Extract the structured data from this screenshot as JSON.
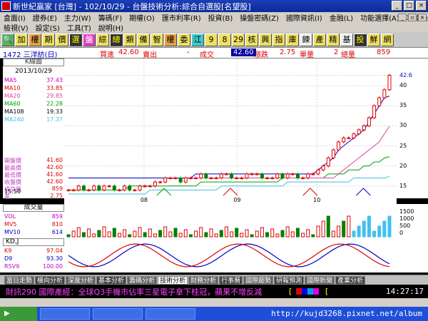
{
  "window": {
    "title": "新世紀贏家 [台灣] - 102/10/29 - 台盤技術分析:綜合自選股[名望股]"
  },
  "menu": {
    "row1": [
      "盒面(I)",
      "證券(E)",
      "主力(W)",
      "籌碼(F)",
      "期權(O)",
      "匯市利率(R)",
      "投資(B)",
      "操盤密碼(Z)",
      "國際資訊(I)",
      "金融(L)",
      "功能選擇(A)",
      "功能操作(P)"
    ],
    "row2": [
      "檢視(V)",
      "設定(S)",
      "工具(T)",
      "說明(H)"
    ]
  },
  "toolbar": {
    "buttons": [
      "🔍",
      "加",
      "權",
      "期",
      "價",
      "選",
      "盤",
      "綜",
      "總",
      "類",
      "備",
      "智",
      "權",
      "委",
      "江",
      "9",
      "8",
      "29",
      "核",
      "興",
      "指",
      "庫",
      "鍊",
      "產",
      "精",
      "基",
      "投",
      "鮮",
      "網"
    ]
  },
  "quote": {
    "code_name": "1472 三洋紡(日)",
    "buy_label": "買進",
    "buy_value": "42.60",
    "sell_label": "賣出",
    "sell_value": "-",
    "deal_label": "成交",
    "deal_value": "42.60",
    "change_label": "漲跌",
    "change_value": "2.75",
    "single_label": "單量",
    "single_value": "2",
    "total_label": "總量",
    "total_value": "859"
  },
  "legend": {
    "header": "K線圖",
    "date": "2013/10/29",
    "ma": [
      {
        "name": "MA5",
        "value": "37.43",
        "color": "#c000c0"
      },
      {
        "name": "MA10",
        "value": "33.85",
        "color": "#e00000"
      },
      {
        "name": "MA20",
        "value": "29.85",
        "color": "#e040a0"
      },
      {
        "name": "MA60",
        "value": "22.28",
        "color": "#00a000"
      },
      {
        "name": "MA108",
        "value": "19.33",
        "color": "#000000"
      },
      {
        "name": "MA240",
        "value": "17.37",
        "color": "#40c0e0"
      }
    ],
    "prices": [
      {
        "name": "開盤價",
        "value": "41.60"
      },
      {
        "name": "最高價",
        "value": "42.60"
      },
      {
        "name": "最低價",
        "value": "41.60"
      },
      {
        "name": "收盤價",
        "value": "42.60"
      },
      {
        "name": "成交量",
        "value": "859"
      },
      {
        "name": "差",
        "value": "2.75"
      }
    ],
    "time_label": "15:50"
  },
  "chart_data": {
    "type": "candlestick",
    "ylim": [
      13,
      45
    ],
    "y_ticks": [
      42.6,
      40,
      35,
      30,
      25,
      20,
      15
    ],
    "x_ticks": [
      {
        "label": "08",
        "pos": 0.24
      },
      {
        "label": "09",
        "pos": 0.52
      },
      {
        "label": "10",
        "pos": 0.76
      }
    ],
    "price_path": [
      14,
      14,
      15,
      14,
      14,
      15,
      14,
      15,
      15,
      14,
      14,
      15,
      14,
      14,
      15,
      15,
      15,
      16,
      16,
      17,
      17,
      17,
      16,
      17,
      17,
      17,
      18,
      17,
      17,
      17,
      18,
      18,
      17,
      17,
      17,
      18,
      18,
      18,
      17,
      17,
      17,
      18,
      17,
      18,
      18,
      17,
      17,
      18,
      18,
      19,
      20,
      22,
      24,
      26,
      27,
      27,
      28,
      29,
      30,
      32,
      35,
      37,
      39,
      42.6
    ],
    "ma5": [
      17,
      17,
      17,
      17,
      17,
      17,
      17,
      17,
      17,
      17,
      17,
      17,
      17,
      17,
      17,
      17,
      17,
      17,
      17,
      17,
      17,
      17,
      17,
      17,
      17,
      18,
      18,
      18,
      18,
      18,
      18,
      18,
      18,
      18,
      18,
      18,
      18,
      18,
      18,
      18,
      18,
      18,
      18,
      18,
      18,
      18,
      18,
      18,
      18,
      19,
      20,
      21,
      22,
      24,
      25,
      26,
      27,
      28,
      29,
      31,
      33,
      35,
      37,
      37.43
    ],
    "ma20": [
      17,
      17,
      17,
      17,
      17,
      17,
      17,
      17,
      17,
      17,
      17,
      17,
      17,
      17,
      17,
      17,
      17,
      17,
      17,
      17,
      17,
      17,
      17,
      17,
      17,
      17,
      17,
      17,
      17,
      17,
      17,
      17,
      17,
      17,
      17,
      17,
      17,
      17,
      17,
      17,
      17,
      17,
      17,
      17,
      17,
      17,
      17,
      17,
      17,
      17,
      17,
      17,
      17,
      18,
      19,
      20,
      21,
      22,
      23,
      24,
      25,
      26,
      28,
      29.85
    ],
    "ma60": [
      14,
      14,
      14,
      14,
      14,
      14,
      14,
      14,
      14,
      14,
      14,
      14,
      15,
      15,
      15,
      15,
      15,
      15,
      15,
      15,
      15,
      15,
      15,
      15,
      15,
      15,
      16,
      16,
      16,
      16,
      16,
      16,
      16,
      16,
      16,
      16,
      16,
      16,
      16,
      16,
      16,
      16,
      17,
      17,
      17,
      17,
      17,
      17,
      17,
      17,
      17,
      18,
      18,
      18,
      18,
      19,
      19,
      19,
      20,
      20,
      21,
      21,
      22,
      22.28
    ],
    "ma240": [
      13,
      13,
      13,
      13,
      13,
      13,
      13,
      13,
      13,
      13,
      13,
      13,
      13,
      13,
      13,
      13,
      14,
      14,
      14,
      14,
      14,
      14,
      14,
      14,
      14,
      14,
      14,
      14,
      14,
      14,
      15,
      15,
      15,
      15,
      15,
      15,
      15,
      15,
      15,
      15,
      15,
      15,
      15,
      16,
      16,
      16,
      16,
      16,
      16,
      16,
      16,
      16,
      16,
      16,
      16,
      16,
      17,
      17,
      17,
      17,
      17,
      17,
      17,
      17.37
    ],
    "volume": {
      "series": [
        {
          "name": "VOL",
          "value": "859"
        },
        {
          "name": "MV5",
          "value": "810"
        },
        {
          "name": "MV10",
          "value": "614"
        }
      ],
      "y_ticks": [
        "1500",
        "1000",
        "500",
        "0"
      ]
    },
    "kd": {
      "series": [
        {
          "name": "K9",
          "value": "97.04"
        },
        {
          "name": "D9",
          "value": "93.30"
        },
        {
          "name": "RSV9",
          "value": "100.00"
        }
      ]
    }
  },
  "panels": {
    "volume_header": "成交量",
    "kd_header": "KD,J"
  },
  "tabs": [
    "當日走勢",
    "橫向分析",
    "深度分析",
    "基本分析",
    "籌碼分析",
    "技術分析",
    "財務分析",
    "行事曆",
    "國際趨勢",
    "研報預測",
    "國際新聞",
    "產業分析"
  ],
  "active_tab": "技術分析",
  "ticker": {
    "text": "財訊290 國際產經：全球Q3手機市佔率三星電子拿下桂冠，蘋果不增反減",
    "clock": "14:27:17"
  },
  "taskbar": {
    "url": "http://kujd3268.pixnet.net/album"
  }
}
